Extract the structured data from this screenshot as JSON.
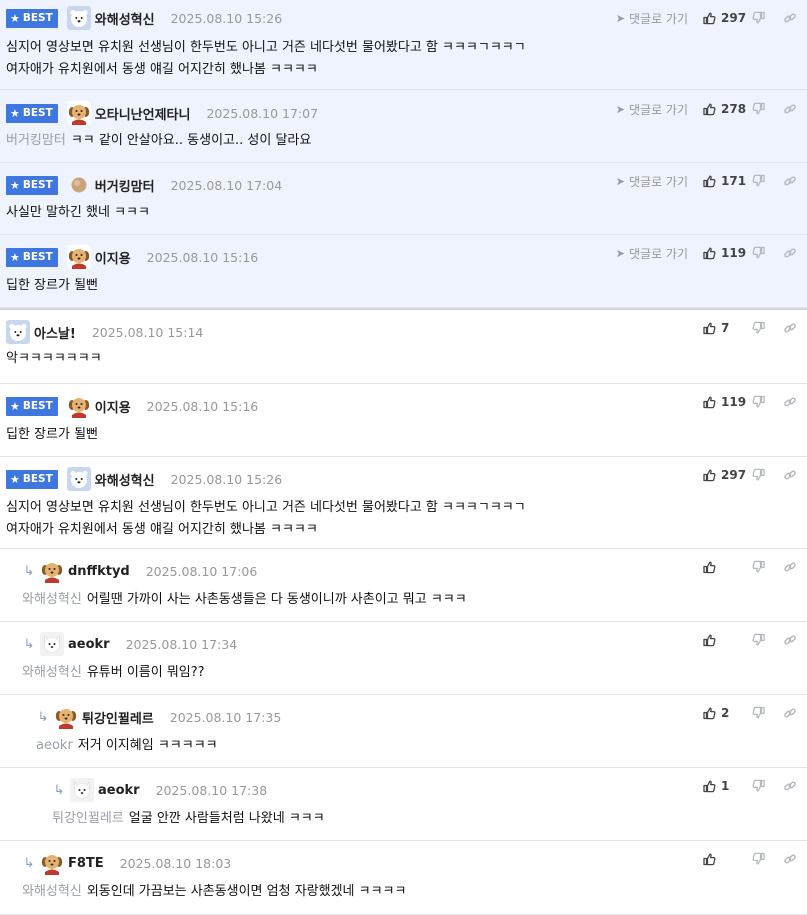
{
  "labels": {
    "best": "BEST",
    "goto": "댓글로 가기"
  },
  "colors": {
    "best_background": "#eef3fd",
    "badge": "#3d77df",
    "mention": "#9aa0a8",
    "timestamp": "#999999"
  },
  "comments": [
    {
      "id": "c0",
      "best": true,
      "avatar": "polar-bear",
      "nick": "와해성혁신",
      "time": "2025.08.10 15:26",
      "goto": true,
      "likes": "297",
      "lines": [
        "심지어 영상보면 유치원 선생님이 한두번도 아니고 거즌 네다섯번 물어봤다고 함 ㅋㅋㅋㄱㅋㅋㄱ",
        "여자애가 유치원에서 동생 얘길 어지간히 했나봄 ㅋㅋㅋㅋ"
      ],
      "mention": ""
    },
    {
      "id": "c1",
      "best": true,
      "avatar": "puppy",
      "nick": "오타니난언제타니",
      "time": "2025.08.10 17:07",
      "goto": true,
      "likes": "278",
      "lines": [
        "ㅋㅋ 같이 안살아요.. 동생이고.. 성이 달라요"
      ],
      "mention": "버거킹맘터"
    },
    {
      "id": "c2",
      "best": true,
      "avatar": "ball",
      "nick": "버거킹맘터",
      "time": "2025.08.10 17:04",
      "goto": true,
      "likes": "171",
      "lines": [
        "사실만 말하긴 했네 ㅋㅋㅋ"
      ],
      "mention": ""
    },
    {
      "id": "c3",
      "best": true,
      "avatar": "puppy",
      "nick": "이지용",
      "time": "2025.08.10 15:16",
      "goto": true,
      "likes": "119",
      "lines": [
        "딥한 장르가 될뻔"
      ],
      "mention": ""
    },
    {
      "id": "c4",
      "best": false,
      "avatar": "polar-bear",
      "nick": "아스날!",
      "time": "2025.08.10 15:14",
      "goto": false,
      "likes": "7",
      "lines": [
        "악ㅋㅋㅋㅋㅋㅋㅋ"
      ],
      "mention": ""
    },
    {
      "id": "c5",
      "best": true,
      "avatar": "puppy",
      "nick": "이지용",
      "time": "2025.08.10 15:16",
      "goto": false,
      "likes": "119",
      "lines": [
        "딥한 장르가 될뻔"
      ],
      "mention": ""
    },
    {
      "id": "c6",
      "best": true,
      "avatar": "polar-bear",
      "nick": "와해성혁신",
      "time": "2025.08.10 15:26",
      "goto": false,
      "likes": "297",
      "lines": [
        "심지어 영상보면 유치원 선생님이 한두번도 아니고 거즌 네다섯번 물어봤다고 함 ㅋㅋㅋㄱㅋㅋㄱ",
        "여자애가 유치원에서 동생 얘길 어지간히 했나봄 ㅋㅋㅋㅋ"
      ],
      "mention": ""
    },
    {
      "id": "c7",
      "best": false,
      "avatar": "puppy",
      "nick": "dnffktyd",
      "time": "2025.08.10 17:06",
      "goto": false,
      "likes": "",
      "lines": [
        "어릴땐 가까이 사는 사촌동생들은 다 동생이니까 사촌이고 뭐고 ㅋㅋㅋ"
      ],
      "mention": "와해성혁신"
    },
    {
      "id": "c8",
      "best": false,
      "avatar": "white-dog",
      "nick": "aeokr",
      "time": "2025.08.10 17:34",
      "goto": false,
      "likes": "",
      "lines": [
        "유튜버 이름이 뭐임??"
      ],
      "mention": "와해성혁신"
    },
    {
      "id": "c9",
      "best": false,
      "avatar": "puppy",
      "nick": "튀강인뀔레르",
      "time": "2025.08.10 17:35",
      "goto": false,
      "likes": "2",
      "lines": [
        "저거 이지혜임 ㅋㅋㅋㅋㅋ"
      ],
      "mention": "aeokr"
    },
    {
      "id": "c10",
      "best": false,
      "avatar": "white-dog",
      "nick": "aeokr",
      "time": "2025.08.10 17:38",
      "goto": false,
      "likes": "1",
      "lines": [
        "얼굴 안깐 사람들처럼 나왔네 ㅋㅋㅋ"
      ],
      "mention": "튀강인뀔레르"
    },
    {
      "id": "c11",
      "best": false,
      "avatar": "puppy",
      "nick": "F8TE",
      "time": "2025.08.10 18:03",
      "goto": false,
      "likes": "",
      "lines": [
        "외동인데 가끔보는 사촌동생이면 엄청 자랑했겠네 ㅋㅋㅋㅋ"
      ],
      "mention": "와해성혁신"
    }
  ]
}
